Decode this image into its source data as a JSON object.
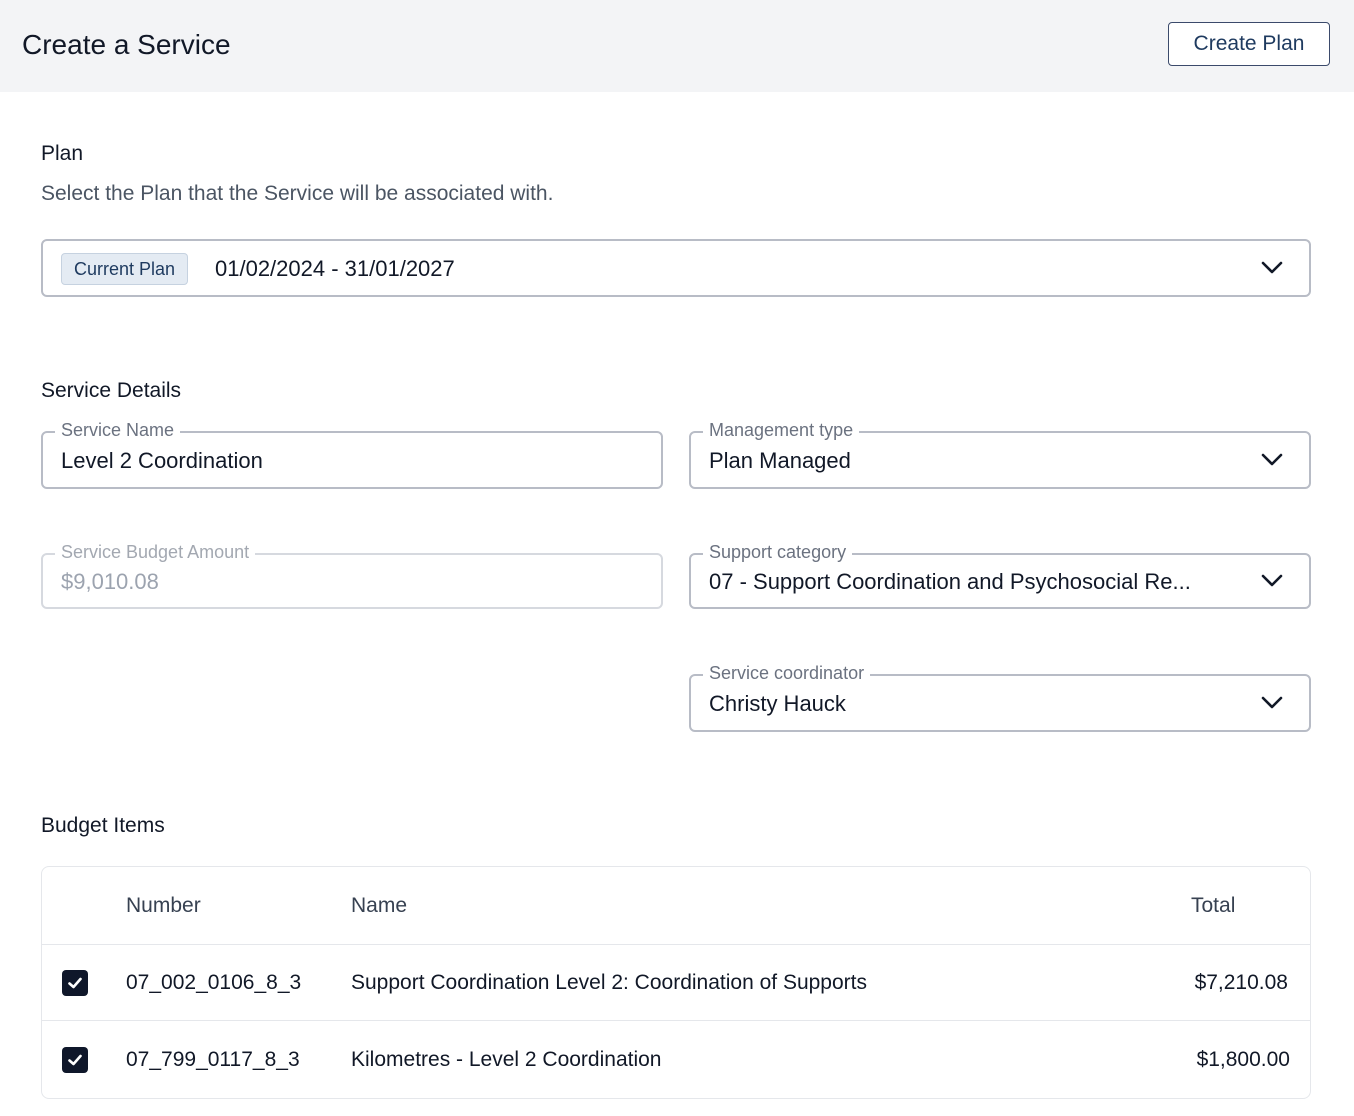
{
  "header": {
    "title": "Create a Service",
    "create_plan_label": "Create Plan"
  },
  "plan_section": {
    "title": "Plan",
    "description": "Select the Plan that the Service will be associated with.",
    "select": {
      "chip": "Current Plan",
      "value": "01/02/2024 - 31/01/2027"
    }
  },
  "service_details": {
    "title": "Service Details",
    "service_name": {
      "label": "Service Name",
      "value": "Level 2 Coordination"
    },
    "management_type": {
      "label": "Management type",
      "value": "Plan Managed"
    },
    "budget_amount": {
      "label": "Service Budget Amount",
      "value": "$9,010.08"
    },
    "support_category": {
      "label": "Support category",
      "value": "07 - Support Coordination and Psychosocial Re..."
    },
    "service_coordinator": {
      "label": "Service coordinator",
      "value": "Christy Hauck"
    }
  },
  "budget_items": {
    "title": "Budget Items",
    "columns": {
      "number": "Number",
      "name": "Name",
      "total": "Total"
    },
    "rows": [
      {
        "checked": true,
        "number": "07_002_0106_8_3",
        "name": "Support Coordination Level 2: Coordination of Supports",
        "total": "$7,210.08"
      },
      {
        "checked": true,
        "number": "07_799_0117_8_3",
        "name": "Kilometres - Level 2 Coordination",
        "total": "$1,800.00"
      }
    ]
  },
  "icons": {
    "dropdown": "chevron-down-icon",
    "checkbox": "check-icon"
  },
  "colors": {
    "header_bg": "#f3f4f6",
    "accent": "#1e3a5f",
    "checkbox_bg": "#0f172a",
    "chip_bg": "#e4ebf3"
  }
}
